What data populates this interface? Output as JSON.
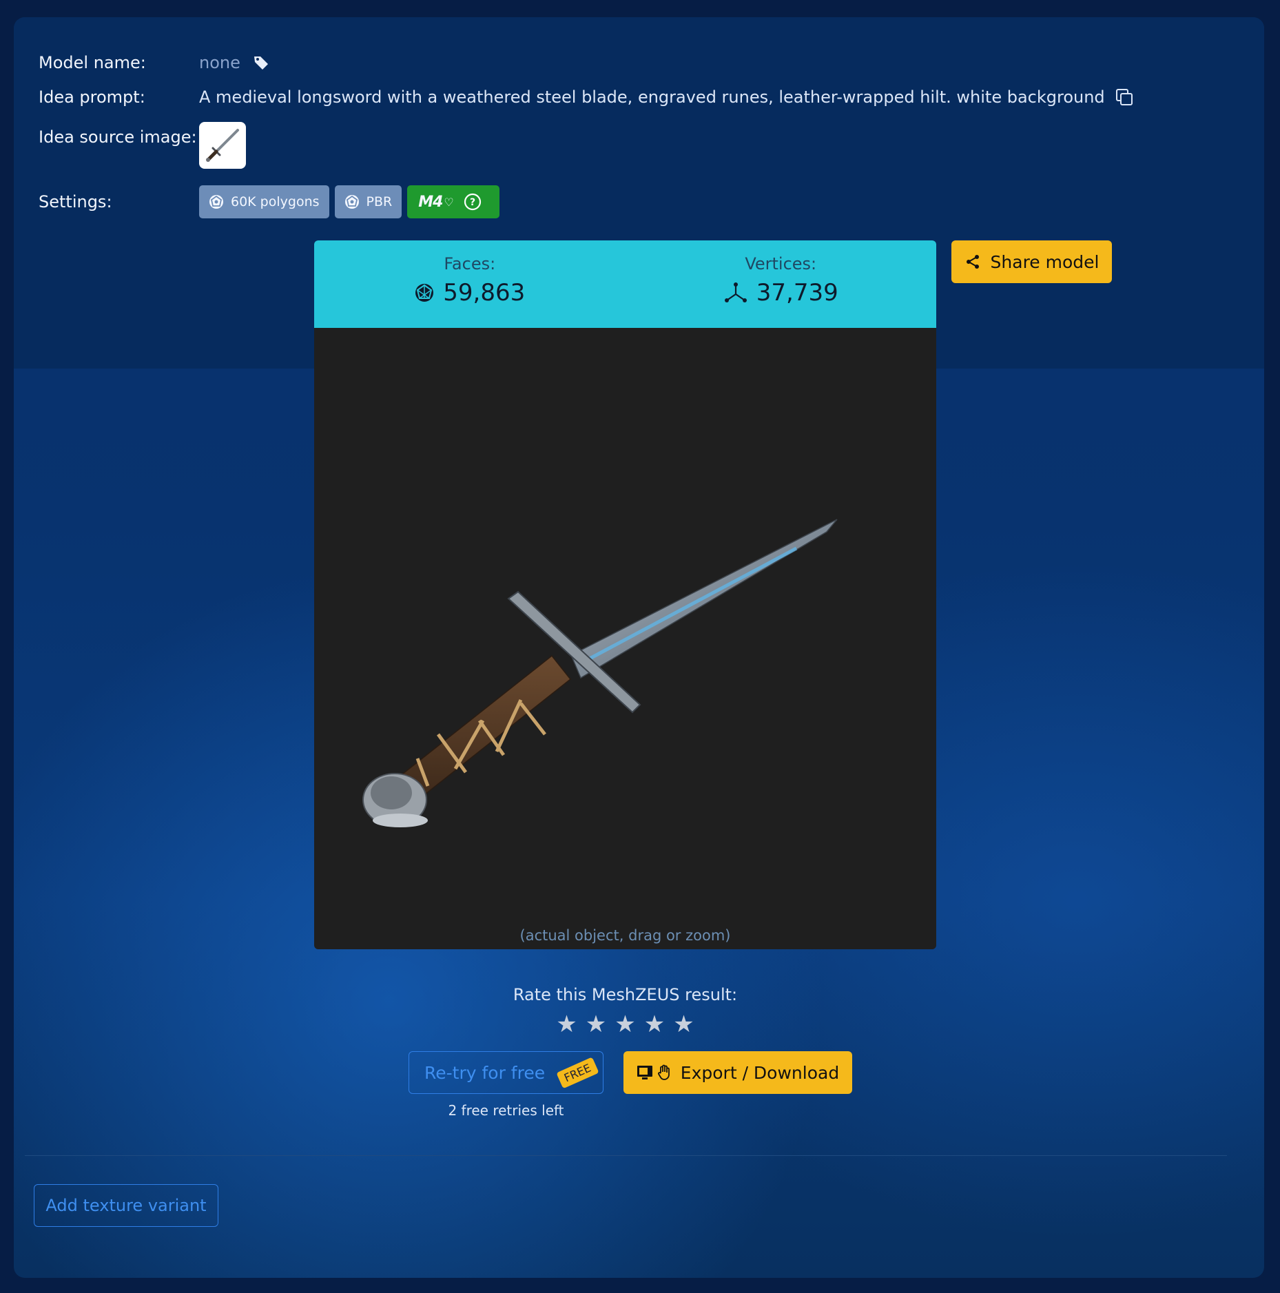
{
  "model": {
    "name_label": "Model name:",
    "name_value": "none",
    "prompt_label": "Idea prompt:",
    "prompt_value": "A medieval longsword with a weathered steel blade, engraved runes, leather-wrapped hilt. white background",
    "source_label": "Idea source image:",
    "settings_label": "Settings:"
  },
  "settings": {
    "polygons": "60K polygons",
    "material": "PBR",
    "model_version": "M4"
  },
  "stats": {
    "faces_label": "Faces:",
    "faces_value": "59,863",
    "vertices_label": "Vertices:",
    "vertices_value": "37,739"
  },
  "viewer": {
    "caption": "(actual object, drag or zoom)"
  },
  "actions": {
    "share_label": "Share model",
    "rate_label": "Rate this MeshZEUS result:",
    "retry_label": "Re-try for free",
    "free_badge": "FREE",
    "retries_left": "2 free retries left",
    "export_label": "Export / Download",
    "texture_label": "Add texture variant"
  },
  "rating": {
    "stars_total": 5,
    "stars_selected": 0
  },
  "colors": {
    "accent_yellow": "#f5b91b",
    "stats_cyan": "#26c6da",
    "link_blue": "#3f8ff0",
    "chip_green": "#1f9a2e"
  }
}
